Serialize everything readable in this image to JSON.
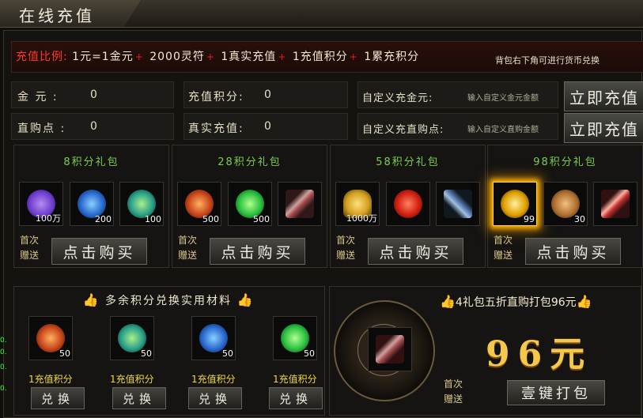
{
  "window": {
    "title": "在线充值"
  },
  "ratio": {
    "label": "充值比例:",
    "items": [
      "1元=1金元",
      "2000灵符",
      "1真实充值",
      "1充值积分",
      "1累充积分"
    ],
    "separator": "+",
    "hint": "背包右下角可进行货币兑换"
  },
  "stats": {
    "gold_label": "金  元 :",
    "gold_value": "0",
    "direct_label": "直购点 :",
    "direct_value": "0",
    "points_label": "充值积分:",
    "points_value": "0",
    "real_label": "真实充值:",
    "real_value": "0"
  },
  "custom": {
    "gold_label": "自定义充金元:",
    "gold_placeholder": "输入自定义金元金额",
    "direct_label": "自定义充直购点:",
    "direct_placeholder": "输入自定义直购金额",
    "charge_button": "立即充值"
  },
  "packages": [
    {
      "title": "8积分礼包",
      "items": [
        {
          "icon": "purple-gem-icon",
          "qty": "100万",
          "color": "#6a3acc"
        },
        {
          "icon": "blue-orb-icon",
          "qty": "200",
          "color": "#2a6ad0"
        },
        {
          "icon": "green-blue-orb-icon",
          "qty": "100",
          "color": "#2aa08a"
        }
      ],
      "first": "首次",
      "gift": "赠送",
      "buy": "点击购买"
    },
    {
      "title": "28积分礼包",
      "items": [
        {
          "icon": "red-helmet-icon",
          "qty": "500",
          "color": "#c8461a"
        },
        {
          "icon": "green-orb-icon",
          "qty": "500",
          "color": "#2ac040"
        },
        {
          "icon": "scroll-icon",
          "qty": "",
          "color": "#a04a4a"
        }
      ],
      "first": "首次",
      "gift": "赠送",
      "buy": "点击购买"
    },
    {
      "title": "58积分礼包",
      "items": [
        {
          "icon": "gold-ingot-icon",
          "qty": "1000万",
          "color": "#d4a020"
        },
        {
          "icon": "red-seal-icon",
          "qty": "",
          "color": "#d02010"
        },
        {
          "icon": "blue-weapon-icon",
          "qty": "",
          "color": "#5a7ab0"
        }
      ],
      "first": "首次",
      "gift": "赠送",
      "buy": "点击购买"
    },
    {
      "title": "98积分礼包",
      "items": [
        {
          "icon": "gold-badge-icon",
          "qty": "99",
          "color": "#e0a000"
        },
        {
          "icon": "bronze-disc-icon",
          "qty": "30",
          "color": "#b07030"
        },
        {
          "icon": "red-scroll-icon",
          "qty": "",
          "color": "#c03030"
        }
      ],
      "first": "首次",
      "gift": "赠送",
      "buy": "点击购买"
    }
  ],
  "exchange": {
    "title": "多余积分兑换实用材料",
    "items": [
      {
        "icon": "red-helmet-icon",
        "qty": "50",
        "cost": "1充值积分",
        "button": "兑换",
        "color": "#c8461a"
      },
      {
        "icon": "green-blue-orb-icon",
        "qty": "50",
        "cost": "1充值积分",
        "button": "兑换",
        "color": "#2aa08a"
      },
      {
        "icon": "blue-orb-icon",
        "qty": "50",
        "cost": "1充值积分",
        "button": "兑换",
        "color": "#2a6ad0"
      },
      {
        "icon": "green-orb-icon",
        "qty": "50",
        "cost": "1充值积分",
        "button": "兑换",
        "color": "#2ac040"
      }
    ]
  },
  "bundle": {
    "title": "4礼包五折直购打包96元",
    "price": "96元",
    "first": "首次",
    "gift": "赠送",
    "button": "壹键打包",
    "item_icon": "scroll-icon"
  },
  "side_marks": [
    "0.",
    "0.",
    "0.",
    "0."
  ]
}
